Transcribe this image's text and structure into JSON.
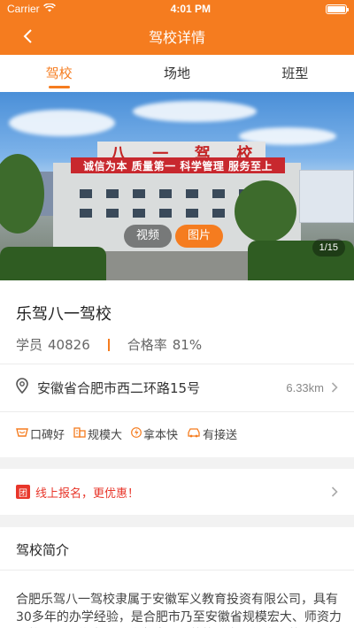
{
  "status_bar": {
    "carrier": "Carrier",
    "time": "4:01 PM"
  },
  "nav": {
    "title": "驾校详情"
  },
  "tabs": [
    {
      "label": "驾校",
      "active": true
    },
    {
      "label": "场地",
      "active": false
    },
    {
      "label": "班型",
      "active": false
    }
  ],
  "hero": {
    "roof_sign": [
      "八",
      "一",
      "驾",
      "校"
    ],
    "banner_text": "诚信为本  质量第一  科学管理  服务至上",
    "media_buttons": [
      {
        "label": "视频",
        "active": false
      },
      {
        "label": "图片",
        "active": true
      }
    ],
    "counter": "1/15"
  },
  "school": {
    "name": "乐驾八一驾校",
    "students_label": "学员",
    "students_value": "40826",
    "pass_rate_label": "合格率",
    "pass_rate_value": "81%",
    "address": "安徽省合肥市西二环路15号",
    "distance": "6.33km",
    "features": [
      {
        "label": "口碑好",
        "icon": "reputation-icon"
      },
      {
        "label": "规模大",
        "icon": "building-icon"
      },
      {
        "label": "拿本快",
        "icon": "lightning-icon"
      },
      {
        "label": "有接送",
        "icon": "car-icon"
      }
    ]
  },
  "promo": {
    "badge": "团",
    "text": "线上报名，更优惠！"
  },
  "intro": {
    "title": "驾校简介",
    "body": "合肥乐驾八一驾校隶属于安徽军义教育投资有限公司，具有30多年的办学经验，是合肥市乃至安徽省规模宏大、师资力量雄厚、设施先进、教学培训规范的国家一级资质的现代"
  },
  "colors": {
    "accent": "#f57c1f",
    "promo_red": "#e8362a"
  }
}
